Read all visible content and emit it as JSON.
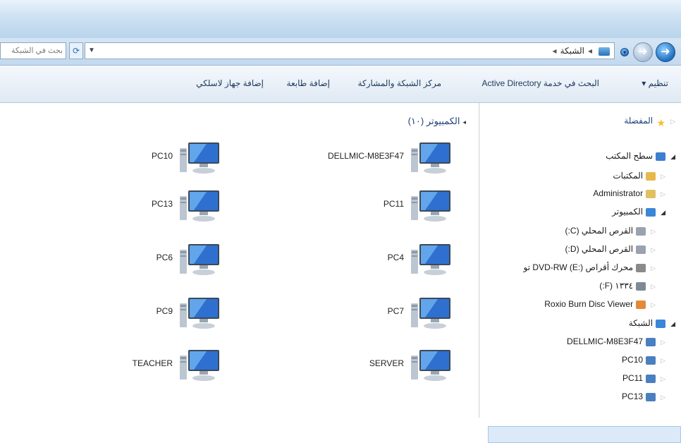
{
  "window": {
    "address_path": [
      "الشبكة"
    ],
    "search_placeholder": "بحث في الشبكة"
  },
  "toolbar": {
    "organize": "تنظيم ▾",
    "search_ad": "البحث في خدمة Active Directory",
    "network_center": "مركز الشبكة والمشاركة",
    "add_printer": "إضافة طابعة",
    "add_wireless": "إضافة جهاز لاسلكي"
  },
  "nav_tree": [
    {
      "label": "المفضلة",
      "icon": "star-icon"
    },
    {
      "label": "سطح المكتب",
      "icon": "desktop-icon"
    },
    {
      "label": "المكتبات",
      "icon": "library-icon"
    },
    {
      "label": "Administrator",
      "icon": "user-folder-icon"
    },
    {
      "label": "الكمبيوتر",
      "icon": "computer-icon"
    },
    {
      "label": "القرص المحلي (C:)",
      "icon": "drive-icon"
    },
    {
      "label": "القرص المحلي (D:)",
      "icon": "drive-icon"
    },
    {
      "label": "محرك أقراص DVD-RW (E:) تو",
      "icon": "dvd-icon"
    },
    {
      "label": "١٣٣٤ (F:)",
      "icon": "usb-drive-icon"
    },
    {
      "label": "Roxio Burn Disc Viewer",
      "icon": "roxio-icon"
    },
    {
      "label": "الشبكة",
      "icon": "network-icon"
    },
    {
      "label": "DELLMIC-M8E3F47",
      "icon": "network-computer-icon"
    },
    {
      "label": "PC10",
      "icon": "network-computer-icon"
    },
    {
      "label": "PC11",
      "icon": "network-computer-icon"
    },
    {
      "label": "PC13",
      "icon": "network-computer-icon"
    }
  ],
  "content": {
    "group_label": "الكمبيوتر (١٠)",
    "computers": [
      "DELLMIC-M8E3F47",
      "PC10",
      "PC11",
      "PC13",
      "PC4",
      "PC6",
      "PC7",
      "PC9",
      "SERVER",
      "TEACHER"
    ]
  },
  "colors": {
    "accent": "#1e3f7a",
    "selection": "#dbe9f8"
  }
}
